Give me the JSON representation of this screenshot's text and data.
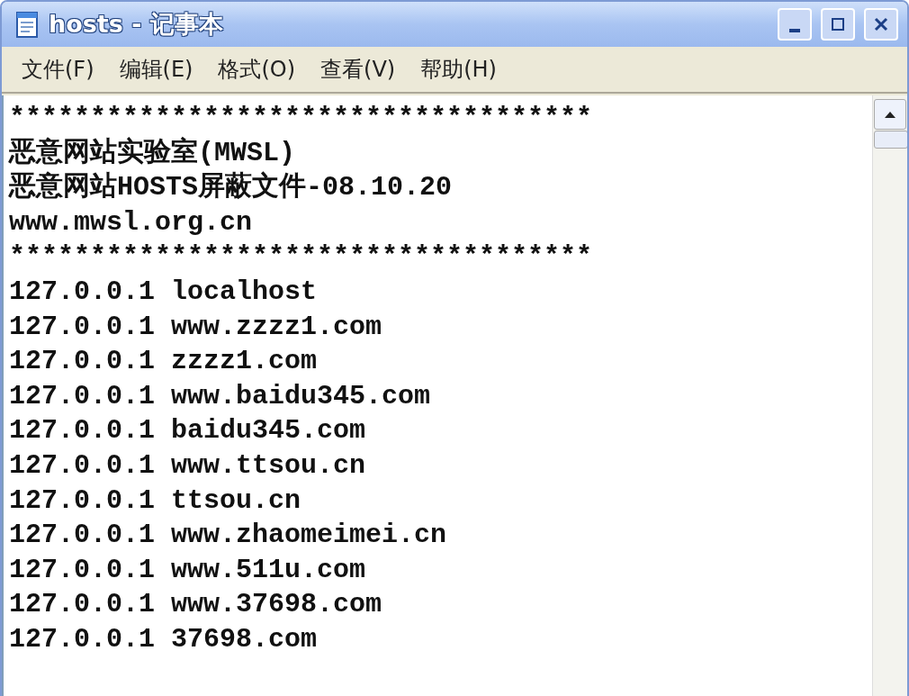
{
  "window": {
    "title": "hosts - 记事本"
  },
  "menu": [
    {
      "label": "文件(F)"
    },
    {
      "label": "编辑(E)"
    },
    {
      "label": "格式(O)"
    },
    {
      "label": "查看(V)"
    },
    {
      "label": "帮助(H)"
    }
  ],
  "lines": [
    "************************************",
    "恶意网站实验室(MWSL)",
    "恶意网站HOSTS屏蔽文件-08.10.20",
    "www.mwsl.org.cn",
    "************************************",
    "127.0.0.1 localhost",
    "127.0.0.1 www.zzzz1.com",
    "127.0.0.1 zzzz1.com",
    "127.0.0.1 www.baidu345.com",
    "127.0.0.1 baidu345.com",
    "127.0.0.1 www.ttsou.cn",
    "127.0.0.1 ttsou.cn",
    "127.0.0.1 www.zhaomeimei.cn",
    "127.0.0.1 www.511u.com",
    "127.0.0.1 www.37698.com",
    "127.0.0.1 37698.com"
  ]
}
